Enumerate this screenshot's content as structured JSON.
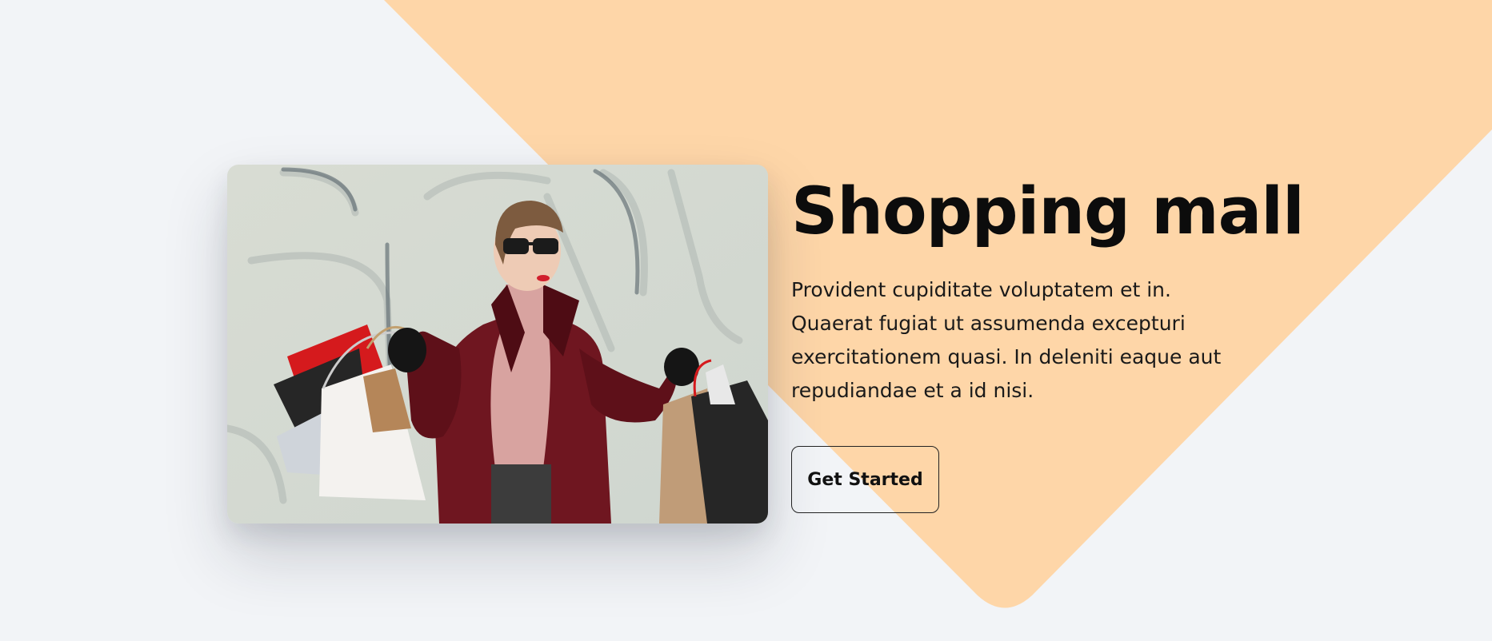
{
  "hero": {
    "title": "Shopping mall",
    "description": "Provident cupiditate voluptatem et in. Quaerat fugiat ut assumenda excepturi exercitationem quasi. In deleniti eaque aut repudiandae et a id nisi.",
    "cta_label": "Get Started",
    "image_icon": "woman-shopping-bags-photo"
  },
  "colors": {
    "background": "#f2f4f7",
    "accent_shape": "#fed6a8",
    "text": "#0c0c0c",
    "button_border": "#222222"
  }
}
